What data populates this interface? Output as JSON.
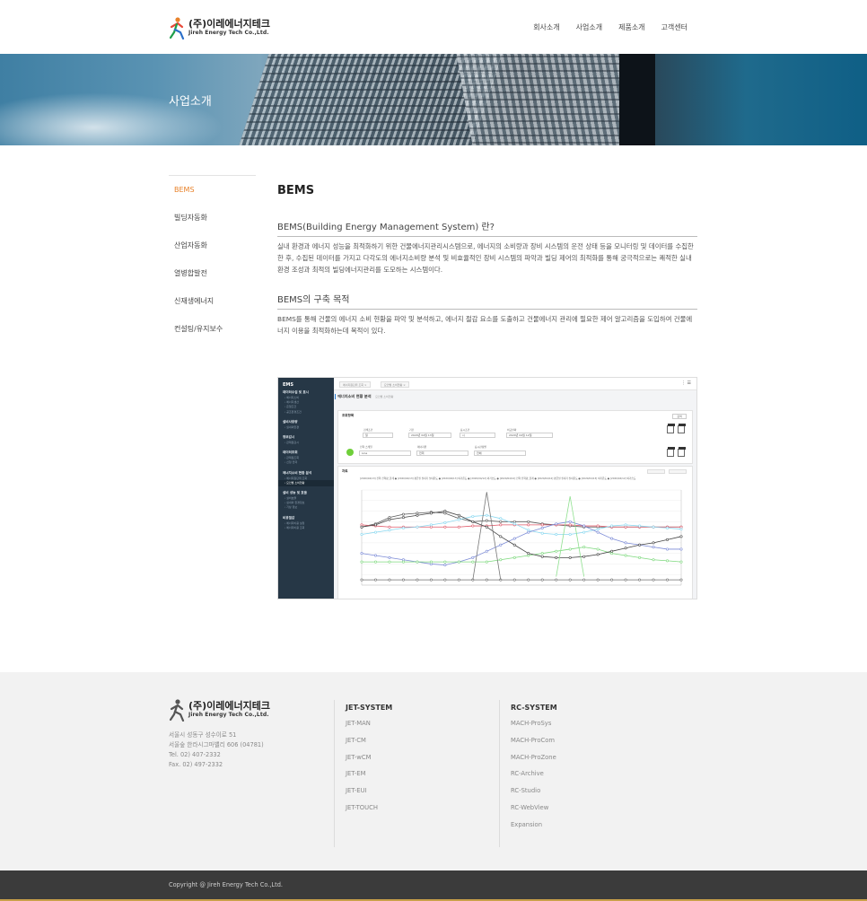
{
  "brand": {
    "name_ko": "(주)이레에너지테크",
    "name_en": "Jireh Energy Tech Co.,Ltd."
  },
  "nav": [
    "회사소개",
    "사업소개",
    "제품소개",
    "고객센터"
  ],
  "hero": {
    "title": "사업소개"
  },
  "sidebar": {
    "items": [
      {
        "label": "BEMS",
        "active": true
      },
      {
        "label": "빌딩자동화"
      },
      {
        "label": "산업자동화"
      },
      {
        "label": "열병합발전"
      },
      {
        "label": "신재생에너지"
      },
      {
        "label": "컨설팅/유지보수"
      }
    ]
  },
  "main": {
    "title": "BEMS",
    "sections": [
      {
        "heading": "BEMS(Building Energy Management System) 란?",
        "body": "실내 환경과 에너지 성능을 최적화하기 위한 건물에너지관리시스템으로, 에너지의 소비량과 장비 시스템의 운전 상태 등을 모니터링 및 데이터를 수집한 한 후, 수집된 데이터를 가지고 다각도의 에너지소비량 분석 및 비효율적인 장비 시스템의 파악과 빌딩 제어의 최적화를 통해 궁극적으로는 쾌적한 실내 환경 조성과 최적의 빌딩에너지관리를 도모하는 시스템이다."
      },
      {
        "heading": "BEMS의 구축 목적",
        "body": "BEMS를 통해 건물의 에너지 소비 현황을 파악 및 분석하고, 에너지 절감 요소를 도출하고 건물에너지 관리에 필요한 제어 알고리즘을 도입하여 건물에너지 이용을 최적화하는데 목적이 있다."
      }
    ]
  },
  "ems": {
    "title": "EMS",
    "groups": [
      {
        "label": "데이터수집 및 표시",
        "subs": [
          "에너지소비",
          "에너지생산",
          "온열조건",
          "공조환경조건"
        ]
      },
      {
        "label": "설비사용량",
        "subs": [
          "실내외환경"
        ]
      },
      {
        "label": "정보감시",
        "subs": [
          "관제점감시"
        ]
      },
      {
        "label": "데이터조회",
        "subs": [
          "관제점조회",
          "신청 전력"
        ]
      },
      {
        "label": "에너지소비 현황 분석",
        "subs": [
          "에너지원단위 조회",
          "요인별 소비현황"
        ]
      },
      {
        "label": "설비 성능 및 효율",
        "subs": [
          "설비효율",
          "실내외 환경정보",
          "기상 정보"
        ]
      },
      {
        "label": "비용절감",
        "subs": [
          "에너지비용 설정",
          "에너지비용 조회"
        ]
      }
    ],
    "tabs": [
      "에너지원단위 조회 ×",
      "요인별 소비현황 ×"
    ],
    "page_heading": "에너지소비 현황 분석",
    "page_sub": "요인별 소비현황",
    "query_label": "조회항목",
    "graph_label": "차트",
    "filters": {
      "f1_label": "검색조건",
      "f1_value": "일",
      "f2_label": "기간",
      "f2_value": "2020년 04월 13일",
      "f3_label": "표시조건",
      "f3_value": "시",
      "f4_label": "비교날짜",
      "f4_value": "2020년 04월 12일",
      "f5_label": "전력 스케일",
      "f5_value": "Line",
      "f6_label": "에너지원",
      "f6_value": "전력",
      "f7_label": "표시관점별",
      "f7_value": "전체"
    },
    "search_btn": "검색",
    "legend": "[2020/04/13] 전력 전력량_합계 ● [2020/04/13] 평균실 실내기 실내온도 ● [2020/04/13] 외기온도 ● [2020/04/12] 외기습도 ● [2020/04/12] 전력 전력량_합계 ● [2020/04/12] 평균실 실내기 실내온도 ● [2020/04/13] 외기온도 ● [2020/04/12] 외기습도"
  },
  "footer": {
    "address": [
      "서울시 성동구 성수이로 51",
      "서울숲 한라시그마밸리 606 (04781)",
      "Tel. 02) 407-2332",
      "Fax. 02) 497-2332"
    ],
    "col1": {
      "title": "JET-SYSTEM",
      "links": [
        "JET-MAN",
        "JET-CM",
        "JET-wCM",
        "JET-EM",
        "JET-EUI",
        "JET-TOUCH"
      ]
    },
    "col2": {
      "title": "RC-SYSTEM",
      "links": [
        "MACH-ProSys",
        "MACH-ProCom",
        "MACH-ProZone",
        "RC-Archive",
        "RC-Studio",
        "RC-WebView",
        "Expansion"
      ]
    },
    "copyright": "Copyright @ Jireh Energy Tech Co.,Ltd."
  },
  "colors": {
    "accent": "#e8822a",
    "dark_sidebar": "#263746"
  }
}
